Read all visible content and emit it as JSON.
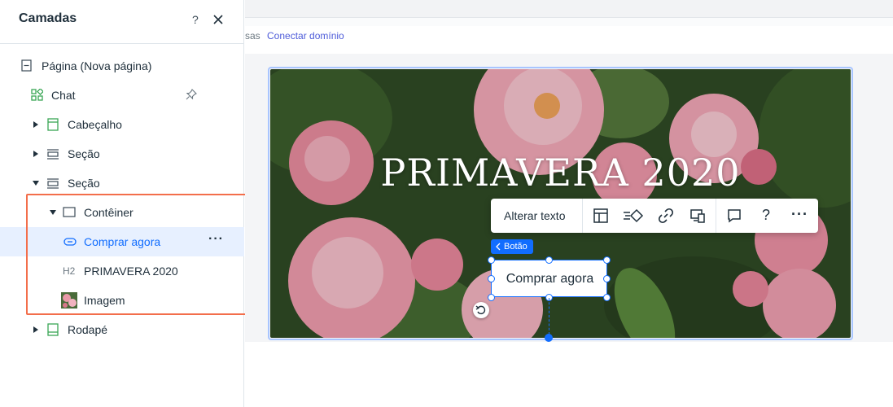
{
  "panel": {
    "title": "Camadas",
    "help_label": "?",
    "close_icon": "close-icon"
  },
  "layers": [
    {
      "label": "Página (Nova página)",
      "icon": "page-icon"
    },
    {
      "label": "Chat",
      "icon": "apps-icon",
      "pinned": true
    },
    {
      "label": "Cabeçalho",
      "icon": "header-icon",
      "expanded": false
    },
    {
      "label": "Seção",
      "icon": "section-icon",
      "expanded": false
    },
    {
      "label": "Seção",
      "icon": "section-icon",
      "expanded": true
    },
    {
      "label": "Contêiner",
      "icon": "container-icon",
      "expanded": true
    },
    {
      "label": "Comprar agora",
      "icon": "button-icon",
      "selected": true,
      "more": "···"
    },
    {
      "label": "PRIMAVERA 2020",
      "icon_text": "H2"
    },
    {
      "label": "Imagem",
      "icon": "image-thumbnail"
    },
    {
      "label": "Rodapé",
      "icon": "footer-icon",
      "expanded": false
    }
  ],
  "editor": {
    "url_prefix": "sas",
    "url_link": "Conectar domínio"
  },
  "hero": {
    "title": "PRIMAVERA 2020"
  },
  "toolbar": {
    "change_text": "Alterar texto",
    "help": "?",
    "more": "···",
    "icons": [
      "layout-icon",
      "animation-icon",
      "link-icon",
      "mobile-desktop-icon",
      "comment-icon",
      "help-icon",
      "more-icon"
    ]
  },
  "selection": {
    "tag_label": "Botão",
    "button_label": "Comprar agora"
  },
  "colors": {
    "accent": "#116dff",
    "highlight": "#f36e4b",
    "link": "#4d5bd9",
    "green_icon": "#3aa655"
  }
}
